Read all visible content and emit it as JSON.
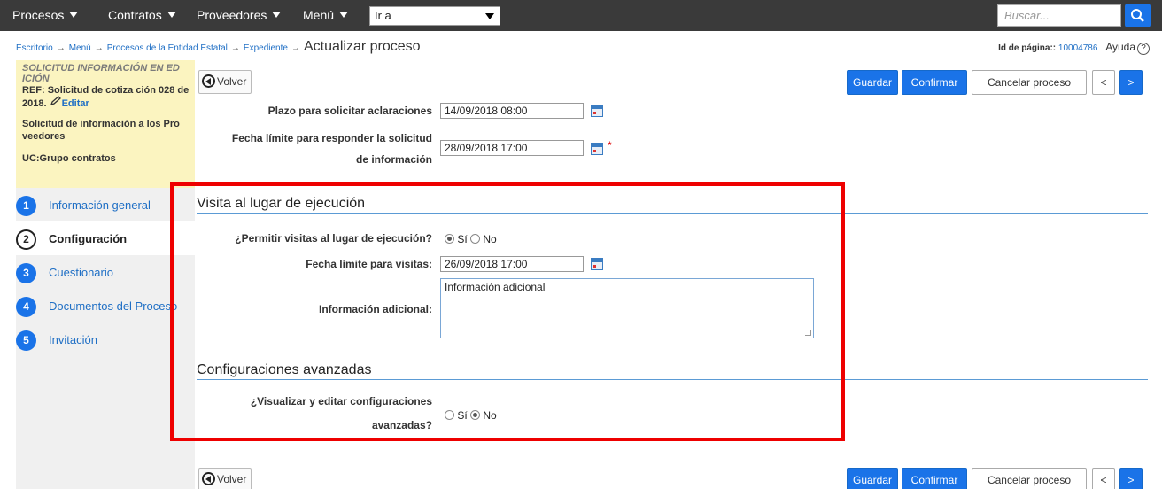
{
  "nav": {
    "items": [
      "Procesos",
      "Contratos",
      "Proveedores",
      "Menú"
    ],
    "goto_value": "Ir a",
    "search_placeholder": "Buscar..."
  },
  "breadcrumb": {
    "links": [
      "Escritorio",
      "Menú",
      "Procesos de la Entidad Estatal",
      "Expediente"
    ],
    "current": "Actualizar proceso"
  },
  "page_info": {
    "id_label": "Id de página::",
    "id_value": "10004786",
    "help_label": "Ayuda"
  },
  "summary": {
    "title": "SOLICITUD INFORMACIÓN EN ED ICIÓN",
    "ref": "REF: Solicitud de cotiza ción 028 de 2018.",
    "edit_label": "Editar",
    "description": "Solicitud de información a los Pro veedores",
    "uc": "UC:Grupo contratos"
  },
  "steps": [
    {
      "num": "1",
      "label": "Información general"
    },
    {
      "num": "2",
      "label": "Configuración"
    },
    {
      "num": "3",
      "label": "Cuestionario"
    },
    {
      "num": "4",
      "label": "Documentos del Proceso"
    },
    {
      "num": "5",
      "label": "Invitación"
    }
  ],
  "toolbar": {
    "back": "Volver",
    "save": "Guardar",
    "confirm": "Confirmar",
    "cancel": "Cancelar proceso",
    "prev": "<",
    "next": ">"
  },
  "form": {
    "plazo_label": "Plazo para solicitar aclaraciones",
    "plazo_value": "14/09/2018 08:00",
    "fecha_resp_label_1": "Fecha límite para responder la solicitud",
    "fecha_resp_label_2": "de información",
    "fecha_resp_value": "28/09/2018 17:00",
    "required_mark": "*"
  },
  "visita": {
    "section_title": "Visita al lugar de ejecución",
    "permitir_label": "¿Permitir visitas al lugar de ejecución?",
    "yes": "Sí",
    "no": "No",
    "selected": "Sí",
    "fecha_label": "Fecha límite para visitas:",
    "fecha_value": "26/09/2018 17:00",
    "info_label": "Información adicional:",
    "info_value": "Información adicional"
  },
  "avanzadas": {
    "section_title": "Configuraciones avanzadas",
    "question_1": "¿Visualizar y editar configuraciones",
    "question_2": "avanzadas?",
    "yes": "Sí",
    "no": "No",
    "selected": "No"
  },
  "colors": {
    "accent": "#1a73e8",
    "highlight": "#ee0000",
    "summary_bg": "#fbf4c0"
  }
}
